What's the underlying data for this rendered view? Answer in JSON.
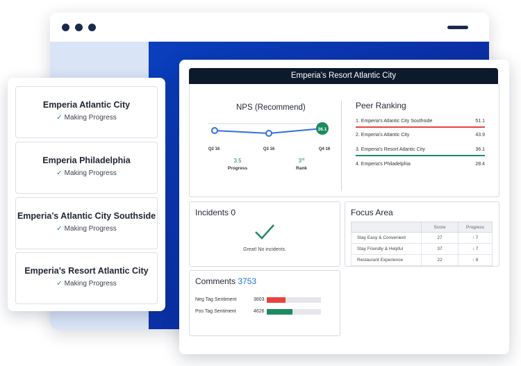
{
  "locations": [
    {
      "name": "Emperia Atlantic City",
      "status": "Making Progress"
    },
    {
      "name": "Emperia Philadelphia",
      "status": "Making Progress"
    },
    {
      "name": "Emperia’s Atlantic City Southside",
      "status": "Making Progress"
    },
    {
      "name": "Emperia’s Resort Atlantic City",
      "status": "Making Progress"
    }
  ],
  "dashboard": {
    "title": "Emperia’s Resort Atlantic City",
    "nps": {
      "title": "NPS (Recommend)",
      "x_labels": [
        "Q2 16",
        "Q3 16",
        "Q4 16"
      ],
      "end_value_label": "36.1",
      "progress_value": "3.5",
      "progress_label": "Progress",
      "rank_value": "3",
      "rank_suffix": "rd",
      "rank_label": "Rank"
    },
    "peer_ranking": {
      "title": "Peer Ranking",
      "rows": [
        {
          "label": "1. Emperia’s Atlantic City Southside",
          "value": "51.1"
        },
        {
          "label": "2. Emperia’s Atlantic City",
          "value": "43.9"
        },
        {
          "label": "3. Emperia’s Resort Atlantic City",
          "value": "36.1"
        },
        {
          "label": "4. Emperia’s Philadelphia",
          "value": "28.4"
        }
      ]
    },
    "incidents": {
      "title": "Incidents 0",
      "message": "Great! No incidents."
    },
    "focus_area": {
      "title": "Focus Area",
      "headers": [
        "",
        "Score",
        "Progress"
      ],
      "rows": [
        {
          "label": "Stay Easy & Convenient",
          "score": "27",
          "progress": "↑ 7"
        },
        {
          "label": "Stay Friendly & Helpful",
          "score": "37",
          "progress": "↑ 7"
        },
        {
          "label": "Restaurant Experience",
          "score": "22",
          "progress": "↑ 8"
        }
      ]
    },
    "comments": {
      "title": "Comments",
      "count": "3753",
      "rows": [
        {
          "label": "Neg Tag Sentiment",
          "value": "3603",
          "fill": 0.34,
          "color": "#e8423f"
        },
        {
          "label": "Pos Tag Sentiment",
          "value": "4626",
          "fill": 0.48,
          "color": "#1e8a5f"
        }
      ]
    }
  },
  "colors": {
    "accent": "#1f6fd1",
    "positive": "#1e8a5f",
    "negative": "#e8423f",
    "header": "#0d1a2b"
  },
  "icons": {
    "check": "check-icon",
    "big_check": "big-check-icon"
  }
}
